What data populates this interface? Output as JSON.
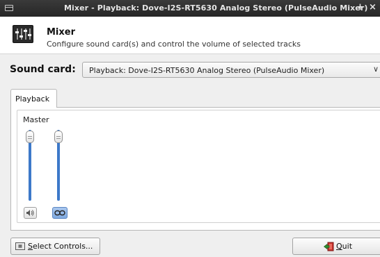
{
  "window": {
    "title": "Mixer - Playback: Dove-I2S-RT5630 Analog Stereo (PulseAudio Mixer)",
    "add_glyph": "+",
    "close_glyph": "×"
  },
  "header": {
    "title": "Mixer",
    "subtitle": "Configure sound card(s) and control the volume of selected tracks",
    "icon": "mixer-icon"
  },
  "sound_card": {
    "label": "Sound card:",
    "selected": "Playback: Dove-I2S-RT5630 Analog Stereo (PulseAudio Mixer)",
    "arrow": "∨"
  },
  "tabs": [
    {
      "label": "Playback",
      "active": true
    }
  ],
  "tracks": [
    {
      "label": "Master",
      "channels": [
        {
          "level": 1.0
        },
        {
          "level": 1.0
        }
      ],
      "mute_icon": "speaker-icon",
      "lock_icon": "link-icon",
      "lock_active": true
    }
  ],
  "footer": {
    "select_controls": {
      "mnemonic": "S",
      "rest": "elect Controls..."
    },
    "quit": {
      "mnemonic": "Q",
      "rest": "uit"
    }
  },
  "colors": {
    "accent": "#3d79c9",
    "titlebar": "#2e2e2e"
  }
}
